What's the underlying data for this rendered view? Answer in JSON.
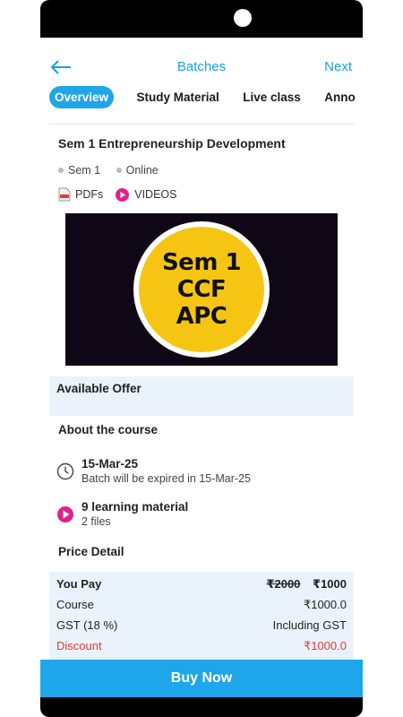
{
  "header": {
    "title": "Batches",
    "next_label": "Next"
  },
  "tabs": [
    {
      "label": "Overview",
      "active": true
    },
    {
      "label": "Study Material",
      "active": false
    },
    {
      "label": "Live class",
      "active": false
    },
    {
      "label": "Anno",
      "active": false
    }
  ],
  "course": {
    "title": "Sem 1 Entrepreneurship Development",
    "meta": [
      "Sem 1",
      "Online"
    ],
    "content_types": [
      "PDFs",
      "VIDEOS"
    ],
    "banner_lines": [
      "Sem 1",
      "CCF",
      "APC"
    ]
  },
  "offer": {
    "title": "Available Offer"
  },
  "about": {
    "title": "About the course",
    "expiry_date": "15-Mar-25",
    "expiry_text": "Batch will be expired in 15-Mar-25",
    "materials_title": "9 learning material",
    "materials_sub": "2 files"
  },
  "price": {
    "title": "Price Detail",
    "you_pay_label": "You Pay",
    "original_price": "₹2000",
    "final_price": "₹1000",
    "course_label": "Course",
    "course_value": "₹1000.0",
    "gst_label": "GST (18 %)",
    "gst_value": "Including GST",
    "discount_label": "Discount",
    "discount_value": "₹1000.0"
  },
  "cta": {
    "buy_label": "Buy Now"
  },
  "colors": {
    "accent": "#1fa5ea",
    "link": "#1a9fe0",
    "panel": "#eaf3fc",
    "discount": "#e53935",
    "badge": "#f6c514"
  }
}
